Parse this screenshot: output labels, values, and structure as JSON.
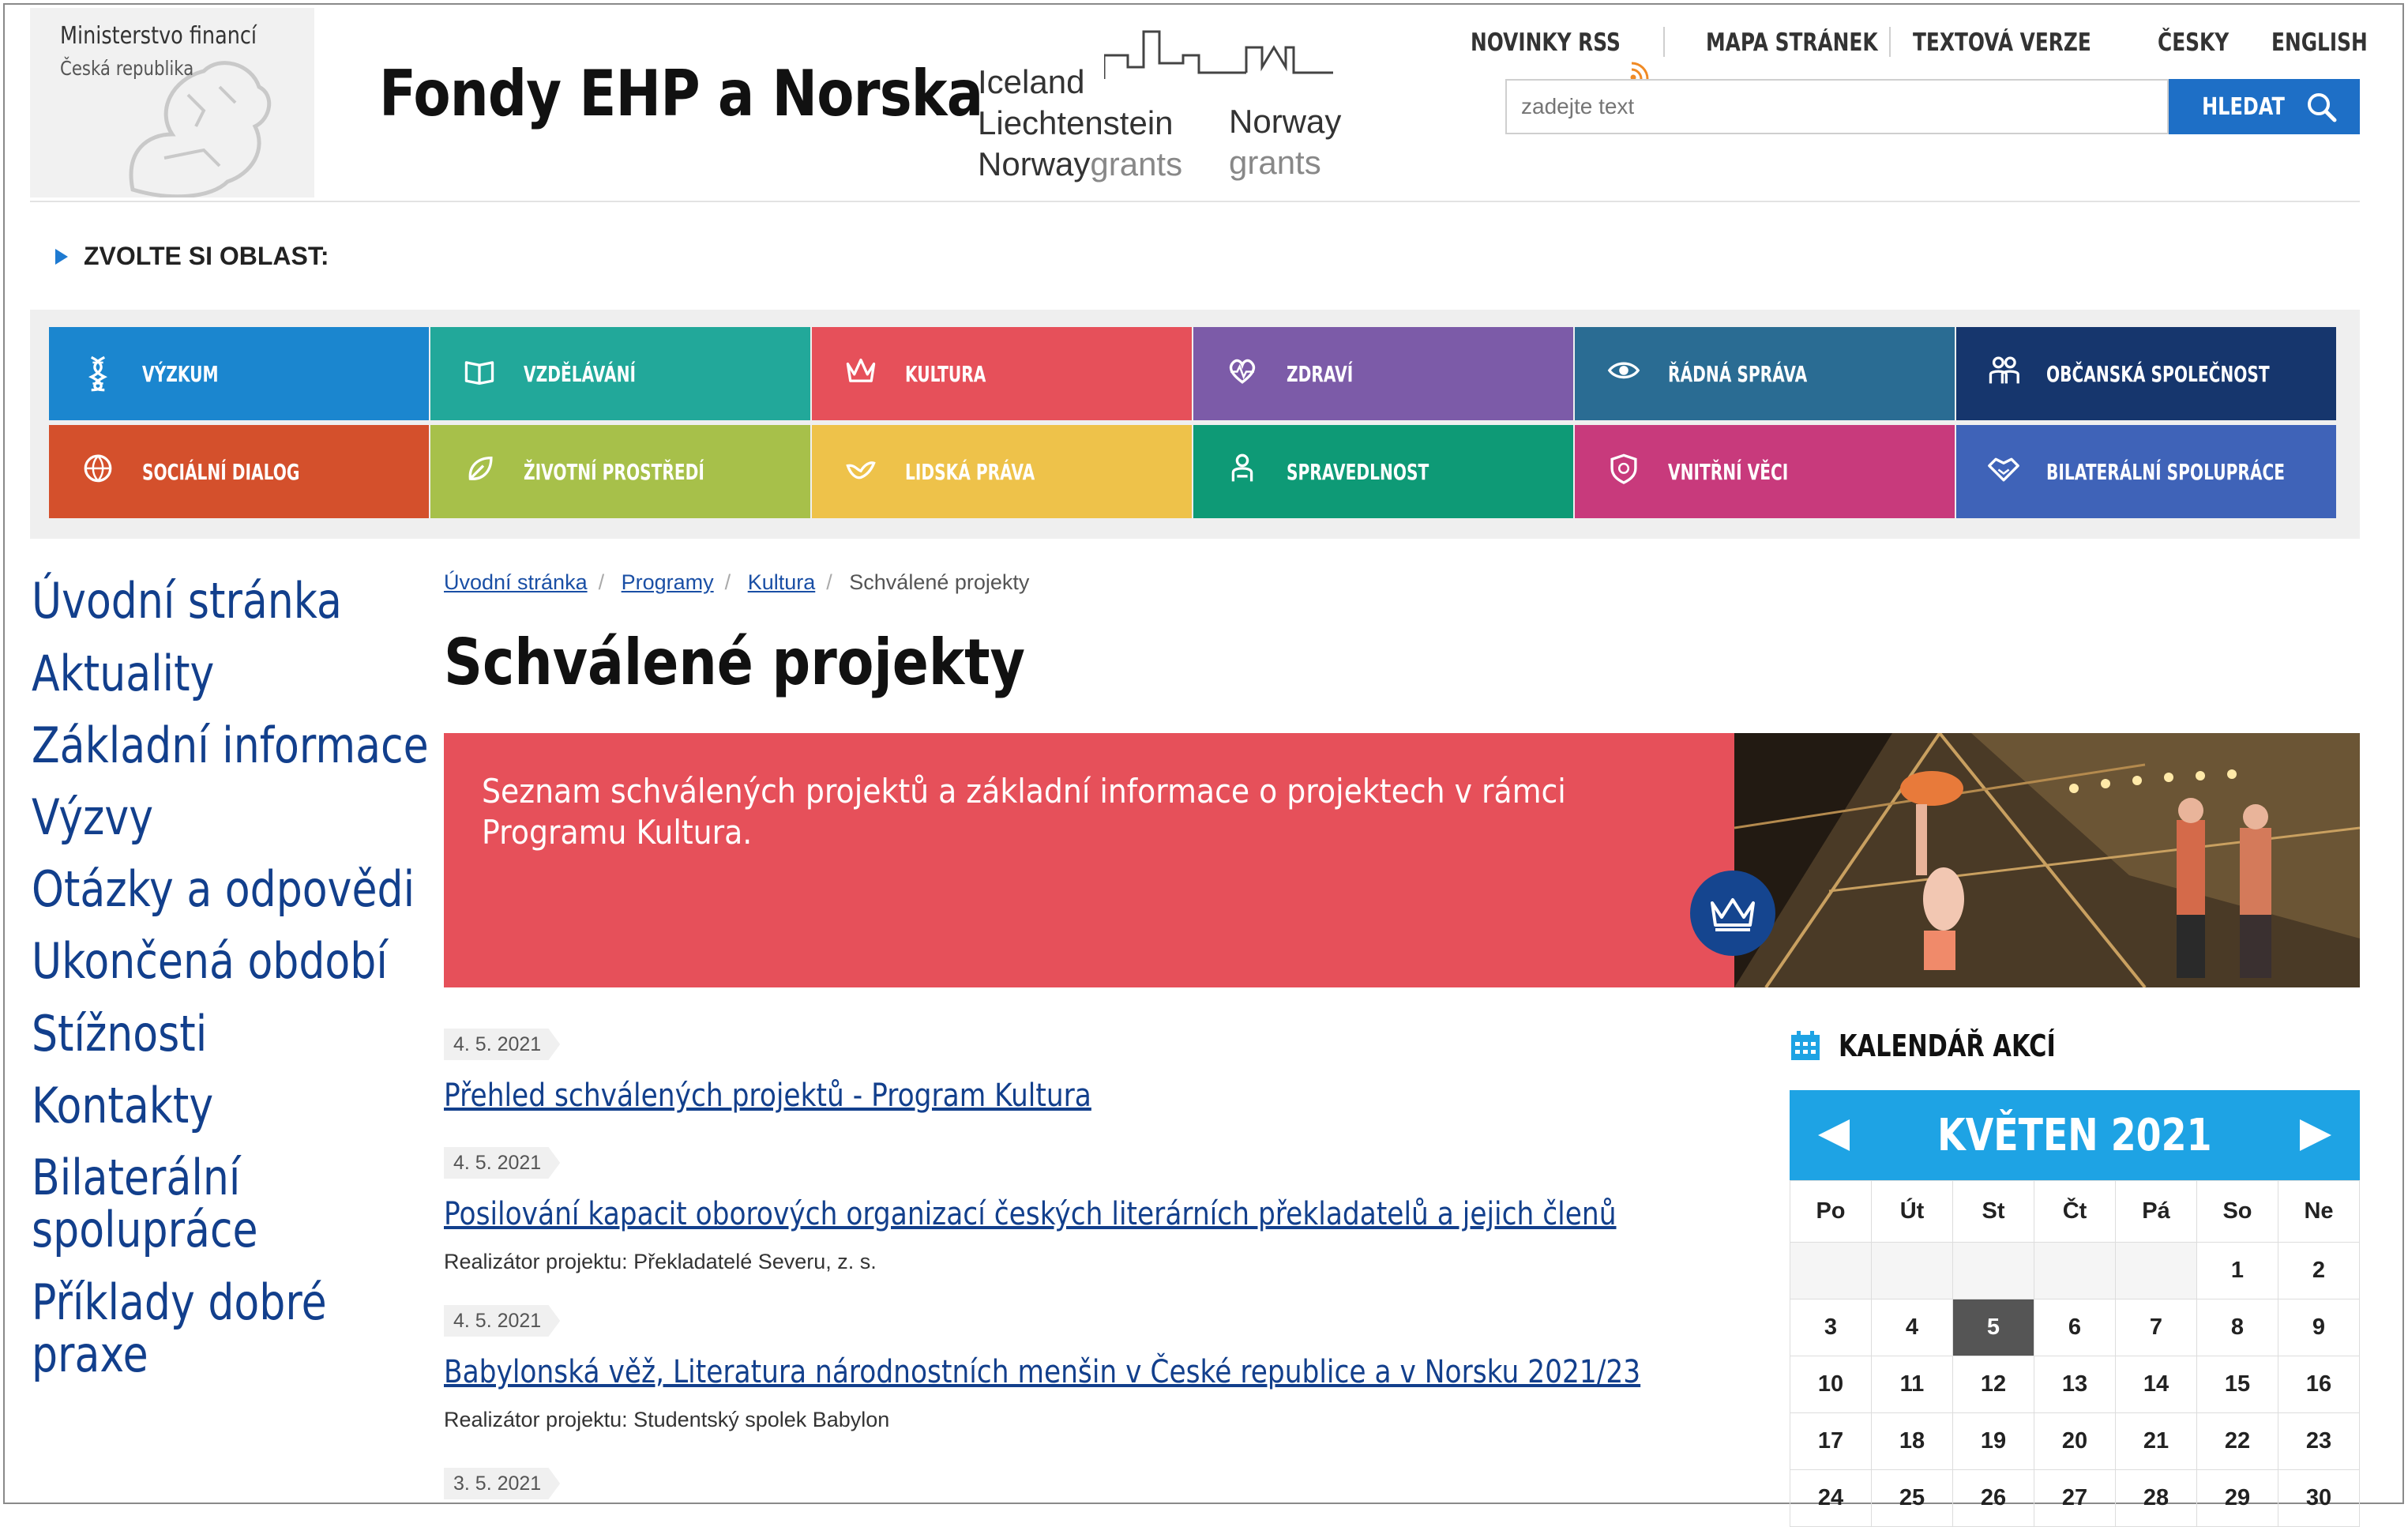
{
  "header": {
    "ministry_line1": "Ministerstvo financí",
    "ministry_line2": "Česká republika",
    "site_title": "Fondy EHP a Norska",
    "grants_logo": {
      "iceland": "Iceland",
      "liechtenstein": "Liechtenstein",
      "norway_a": "Norway",
      "grants_a": "grants",
      "norway_b": "Norway",
      "grants_b": "grants"
    },
    "top_links": {
      "rss": "NOVINKY RSS",
      "sitemap": "MAPA STRÁNEK",
      "text_version": "TEXTOVÁ VERZE",
      "czech": "ČESKY",
      "english": "ENGLISH"
    },
    "search": {
      "placeholder": "zadejte text",
      "button": "HLEDAT"
    }
  },
  "area_selector": {
    "label": "ZVOLTE SI OBLAST:",
    "tiles": [
      {
        "label": "VÝZKUM",
        "color": "#1b86cf",
        "icon": "dna-icon"
      },
      {
        "label": "VZDĚLÁVÁNÍ",
        "color": "#22a89a",
        "icon": "book-icon"
      },
      {
        "label": "KULTURA",
        "color": "#e6505a",
        "icon": "crown-icon"
      },
      {
        "label": "ZDRAVÍ",
        "color": "#7c5ba8",
        "icon": "heartbeat-icon"
      },
      {
        "label": "ŘÁDNÁ SPRÁVA",
        "color": "#2a6c93",
        "icon": "eye-icon"
      },
      {
        "label": "OBČANSKÁ SPOLEČNOST",
        "color": "#16366d",
        "icon": "people-icon"
      },
      {
        "label": "SOCIÁLNÍ DIALOG",
        "color": "#d4502c",
        "icon": "globe-icon"
      },
      {
        "label": "ŽIVOTNÍ PROSTŘEDÍ",
        "color": "#a7c04a",
        "icon": "leaf-icon"
      },
      {
        "label": "LIDSKÁ PRÁVA",
        "color": "#eec24a",
        "icon": "dove-icon"
      },
      {
        "label": "SPRAVEDLNOST",
        "color": "#0e9a76",
        "icon": "justice-icon"
      },
      {
        "label": "VNITŘNÍ VĚCI",
        "color": "#c83a7c",
        "icon": "shield-icon"
      },
      {
        "label": "BILATERÁLNÍ SPOLUPRÁCE",
        "color": "#3f63b8",
        "icon": "handshake-icon"
      }
    ]
  },
  "left_nav": {
    "items": [
      {
        "label": "Úvodní stránka"
      },
      {
        "label": "Aktuality"
      },
      {
        "label": "Základní informace"
      },
      {
        "label": "Výzvy"
      },
      {
        "label": "Otázky a odpovědi"
      },
      {
        "label": "Ukončená období"
      },
      {
        "label": "Stížnosti"
      },
      {
        "label": "Kontakty"
      },
      {
        "label": "Bilaterální",
        "label2": "spolupráce"
      },
      {
        "label": "Příklady dobré",
        "label2": "praxe"
      }
    ]
  },
  "breadcrumb": {
    "items": [
      "Úvodní stránka",
      "Programy",
      "Kultura"
    ],
    "current": "Schválené projekty"
  },
  "page": {
    "title": "Schválené projekty",
    "banner_text": "Seznam schválených projektů a základní informace o projektech v rámci Programu Kultura."
  },
  "articles": [
    {
      "date": "4. 5. 2021",
      "title": "Přehled schválených projektů - Program Kultura",
      "meta": ""
    },
    {
      "date": "4. 5. 2021",
      "title": "Posilování kapacit oborových organizací českých literárních překladatelů a jejich členů",
      "meta": "Realizátor projektu: Překladatelé Severu, z. s."
    },
    {
      "date": "4. 5. 2021",
      "title": "Babylonská věž, Literatura národnostních menšin v České republice a v Norsku 2021/23",
      "meta": "Realizátor projektu: Studentský spolek Babylon"
    },
    {
      "date": "3. 5. 2021",
      "title": "",
      "meta": ""
    }
  ],
  "calendar": {
    "heading": "KALENDÁŘ AKCÍ",
    "month": "KVĚTEN 2021",
    "weekdays": [
      "Po",
      "Út",
      "St",
      "Čt",
      "Pá",
      "So",
      "Ne"
    ],
    "days": [
      "",
      "",
      "",
      "",
      "",
      "1",
      "2",
      "3",
      "4",
      "5",
      "6",
      "7",
      "8",
      "9",
      "10",
      "11",
      "12",
      "13",
      "14",
      "15",
      "16",
      "17",
      "18",
      "19",
      "20",
      "21",
      "22",
      "23",
      "24",
      "25",
      "26",
      "27",
      "28",
      "29",
      "30"
    ],
    "today": "5"
  }
}
